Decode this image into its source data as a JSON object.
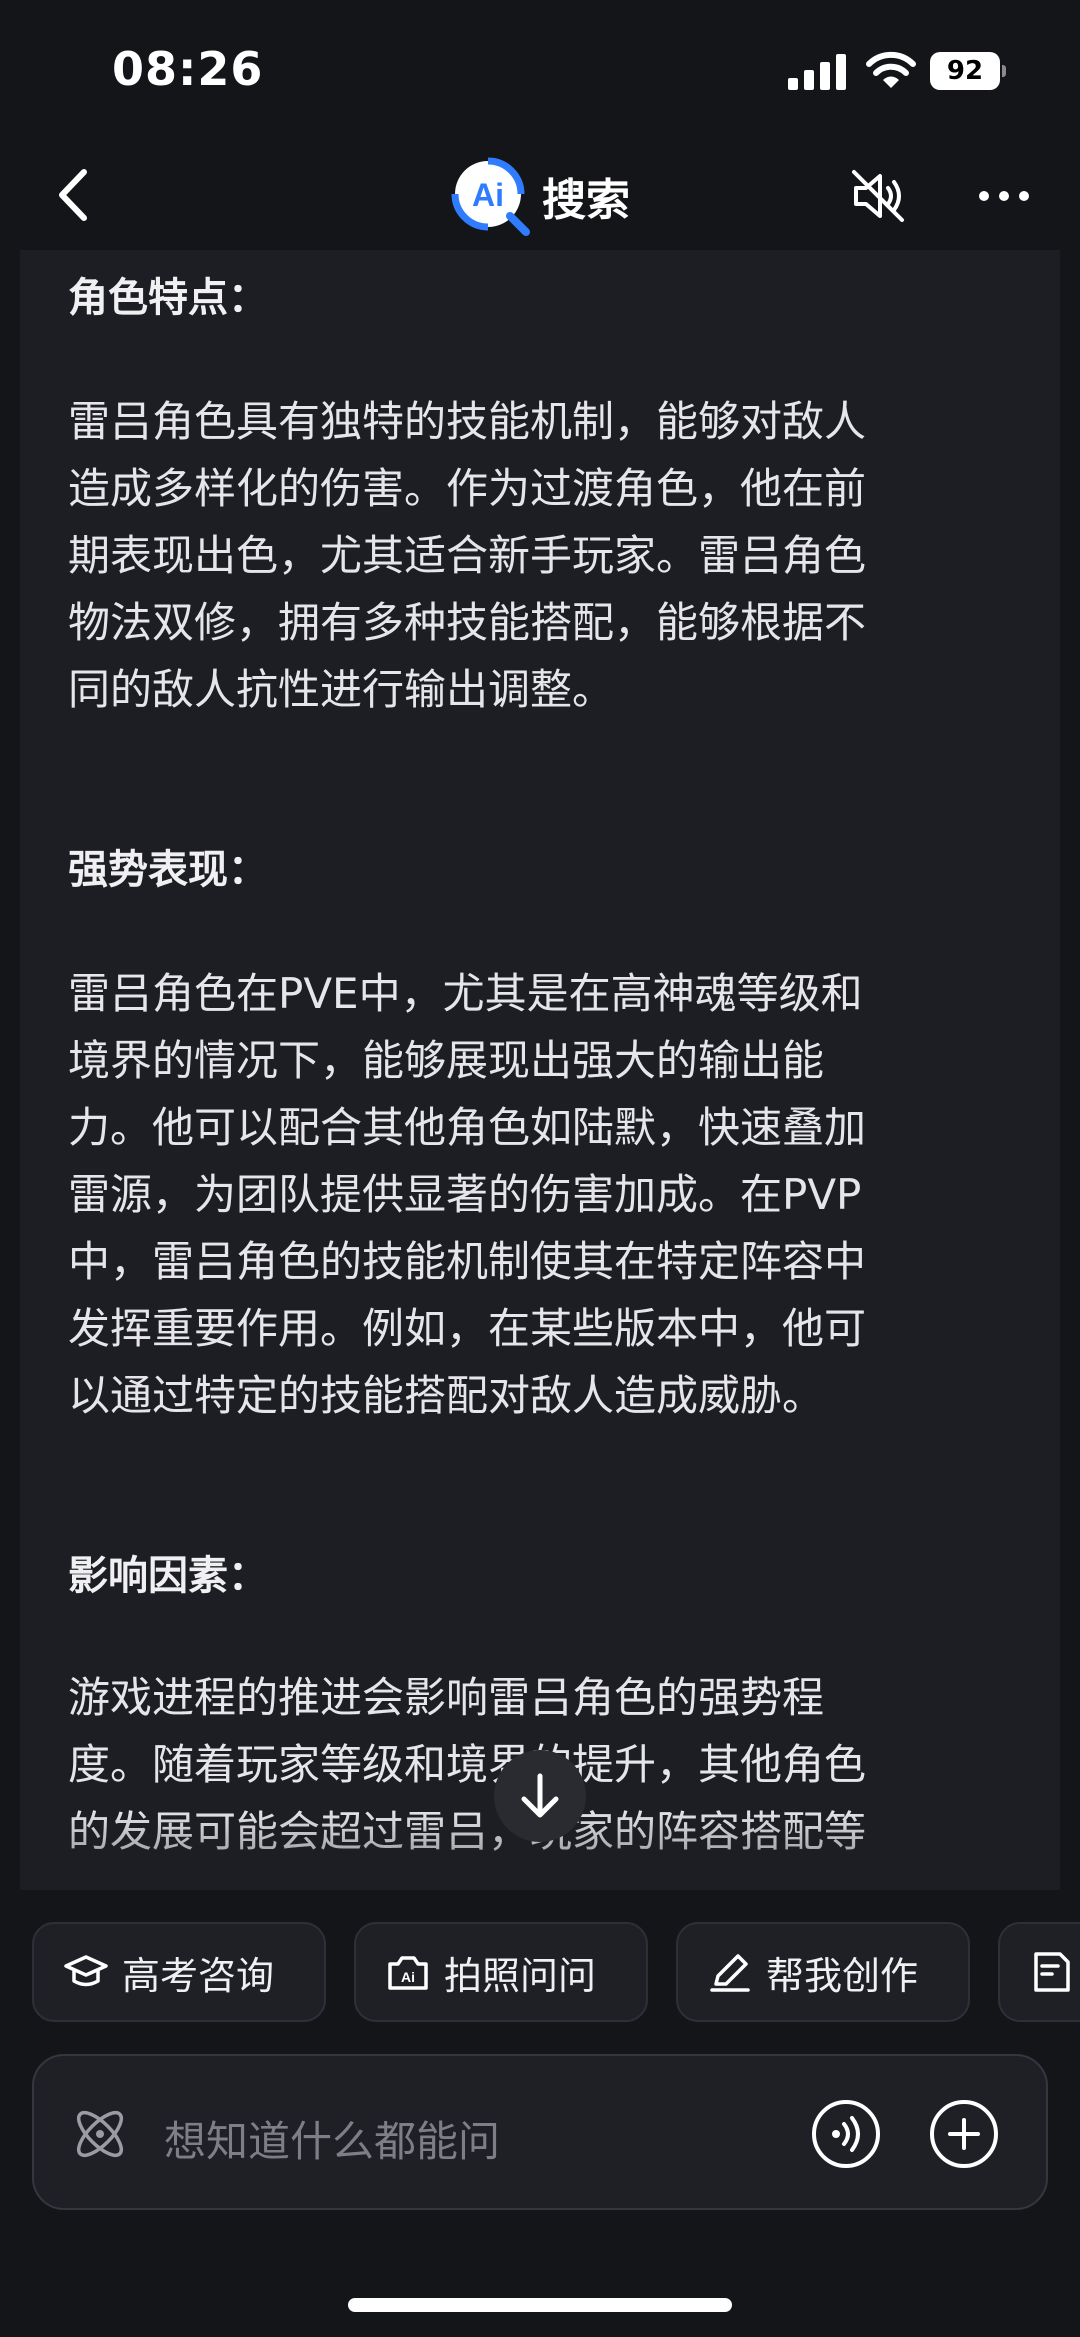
{
  "status_bar": {
    "time": "08:26",
    "battery": "92",
    "icons": [
      "signal-icon",
      "wifi-icon",
      "battery-icon"
    ]
  },
  "nav": {
    "logo_mark": "Ai",
    "title": "搜索",
    "icons": [
      "chevron-left-icon",
      "speaker-muted-icon",
      "more-dots-icon"
    ]
  },
  "article": {
    "sections": [
      {
        "title": "角色特点：",
        "lines": [
          "雷吕角色具有独特的技能机制，能够对敌人",
          "造成多样化的伤害。作为过渡角色，他在前",
          "期表现出色，尤其适合新手玩家。雷吕角色",
          "物法双修，拥有多种技能搭配，能够根据不",
          "同的敌人抗性进行输出调整。"
        ]
      },
      {
        "title": "强势表现：",
        "lines": [
          "雷吕角色在PVE中，尤其是在高神魂等级和",
          "境界的情况下，能够展现出强大的输出能",
          "力。他可以配合其他角色如陆默，快速叠加",
          "雷源，为团队提供显著的伤害加成。在PVP",
          "中，雷吕角色的技能机制使其在特定阵容中",
          "发挥重要作用。例如，在某些版本中，他可",
          "以通过特定的技能搭配对敌人造成威胁。"
        ]
      },
      {
        "title": "影响因素：",
        "lines": [
          "游戏进程的推进会影响雷吕角色的强势程",
          "度。随着玩家等级和境界的提升，其他角色",
          "的发展可能会超过雷吕，玩家的阵容搭配等"
        ]
      }
    ]
  },
  "quick_actions": [
    {
      "label": "高考咨询",
      "icon": "graduation-cap-icon"
    },
    {
      "label": "拍照问问",
      "icon": "camera-ai-icon"
    },
    {
      "label": "帮我创作",
      "icon": "pen-icon"
    },
    {
      "label": "",
      "icon": "document-ai-icon"
    }
  ],
  "input": {
    "placeholder": "想知道什么都能问",
    "icons": [
      "atom-icon",
      "voice-icon",
      "plus-circle-icon"
    ]
  },
  "colors": {
    "background": "#141519",
    "card": "#1d1e24",
    "logo_blue": "#2f7cff"
  }
}
